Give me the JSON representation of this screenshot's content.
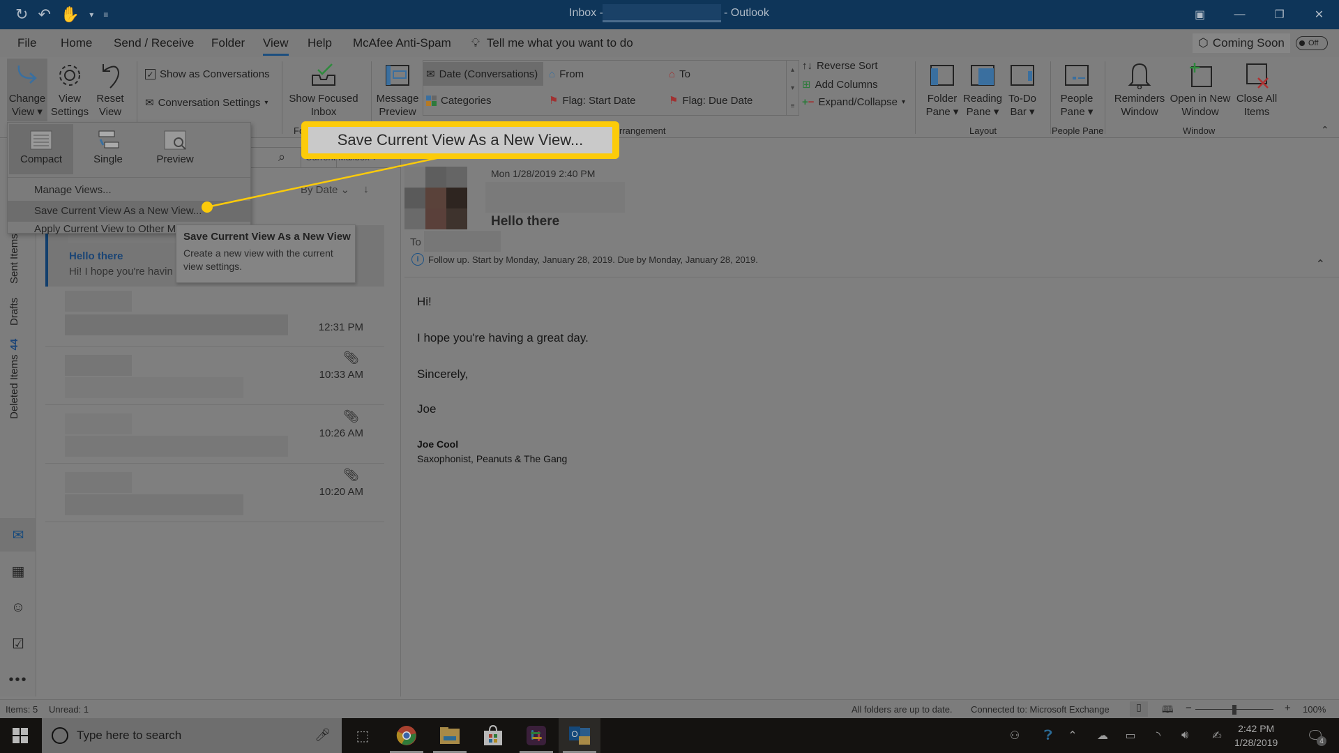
{
  "titlebar": {
    "inbox_label": "Inbox -",
    "app_suffix": "- Outlook",
    "qat_icons": [
      "sync-icon",
      "undo-icon",
      "touch-mode-icon",
      "customize-qat-icon"
    ],
    "controls": [
      "ribbon-display-icon",
      "minimize-icon",
      "restore-icon",
      "close-icon"
    ]
  },
  "menu": {
    "tabs": [
      "File",
      "Home",
      "Send / Receive",
      "Folder",
      "View",
      "Help",
      "McAfee Anti-Spam"
    ],
    "active_tab": "View",
    "tell_me": "Tell me what you want to do",
    "coming_soon": "Coming Soon",
    "toggle_state": "Off"
  },
  "ribbon": {
    "current_view": {
      "change_view": "Change View",
      "view_settings": "View Settings",
      "reset_view": "Reset View"
    },
    "messages": {
      "show_as_conversations": "Show as Conversations",
      "show_as_conversations_checked": true,
      "conversation_settings": "Conversation Settings"
    },
    "focused": {
      "show_focused_inbox": "Show Focused Inbox",
      "group_label_partial": "Fo"
    },
    "arrangement": {
      "message_preview": "Message Preview",
      "options": [
        "Date (Conversations)",
        "From",
        "To",
        "Categories",
        "Flag: Start Date",
        "Flag: Due Date"
      ],
      "selected": "Date (Conversations)",
      "reverse_sort": "Reverse Sort",
      "add_columns": "Add Columns",
      "expand_collapse": "Expand/Collapse",
      "group_label": "Arrangement",
      "group_label_visible": "rrangement"
    },
    "layout": {
      "folder_pane": "Folder Pane",
      "reading_pane": "Reading Pane",
      "todo_bar": "To-Do Bar",
      "group_label": "Layout"
    },
    "people_pane": {
      "people_pane": "People Pane",
      "group_label": "People Pane"
    },
    "window": {
      "reminders_window": "Reminders Window",
      "open_in_new_window": "Open in New Window",
      "close_all_items": "Close All Items",
      "group_label": "Window"
    }
  },
  "dropdown": {
    "views": [
      "Compact",
      "Single",
      "Preview"
    ],
    "selected_view": "Compact",
    "items": [
      "Manage Views...",
      "Save Current View As a New View...",
      "Apply Current View to Other Mail Folders..."
    ],
    "hovered_item": "Save Current View As a New View..."
  },
  "tooltip": {
    "title": "Save Current View As a New View",
    "body": "Create a new view with the current view settings."
  },
  "callout": {
    "label": "Save Current View As a New View...",
    "color": "#fccb0a"
  },
  "folders": {
    "sent_items": "Sent Items",
    "drafts": "Drafts",
    "deleted_items": "Deleted Items",
    "deleted_count": "44"
  },
  "nav_icons": [
    "mail-icon",
    "calendar-icon",
    "people-icon",
    "tasks-icon",
    "more-icon"
  ],
  "message_list": {
    "scope": "Current Mailbox",
    "sort_by": "By Date",
    "messages": [
      {
        "subject": "Hello there",
        "preview": "Hi!   I hope you're havin",
        "time": "",
        "attachment": false,
        "selected": true
      },
      {
        "subject": "",
        "preview": "",
        "time": "12:31 PM",
        "attachment": false,
        "selected": false
      },
      {
        "subject": "",
        "preview": "",
        "time": "10:33 AM",
        "attachment": true,
        "selected": false
      },
      {
        "subject": "",
        "preview": "",
        "time": "10:26 AM",
        "attachment": true,
        "selected": false
      },
      {
        "subject": "",
        "preview": "",
        "time": "10:20 AM",
        "attachment": true,
        "selected": false
      }
    ]
  },
  "reading_pane": {
    "date": "Mon 1/28/2019 2:40 PM",
    "subject": "Hello there",
    "to_label": "To",
    "follow_up": "Follow up.  Start by Monday, January 28, 2019.  Due by Monday, January 28, 2019.",
    "body": [
      "Hi!",
      "I hope you're having a great day.",
      "Sincerely,",
      "Joe"
    ],
    "signature_name": "Joe Cool",
    "signature_title": "Saxophonist, Peanuts & The Gang"
  },
  "statusbar": {
    "items": "Items: 5",
    "unread": "Unread: 1",
    "sync_status": "All folders are up to date.",
    "connection": "Connected to: Microsoft Exchange",
    "zoom": "100%",
    "zoom_fraction": 0.5
  },
  "taskbar": {
    "search_placeholder": "Type here to search",
    "apps": [
      "task-view-icon",
      "chrome-icon",
      "file-explorer-icon",
      "store-icon",
      "slack-icon",
      "outlook-icon"
    ],
    "time": "2:42 PM",
    "date": "1/28/2019",
    "notification_count": "4"
  }
}
